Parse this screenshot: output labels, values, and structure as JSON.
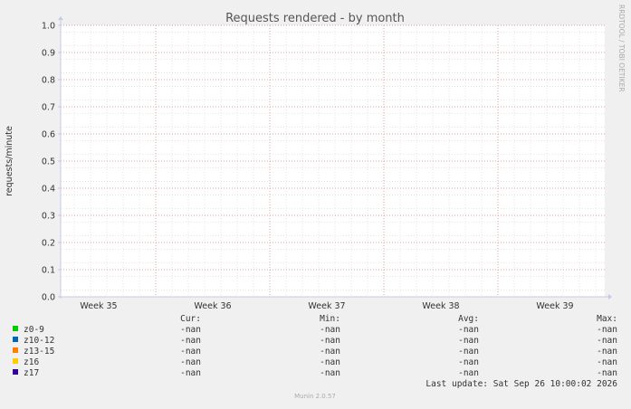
{
  "chart_data": {
    "type": "line",
    "title": "Requests rendered - by month",
    "ylabel": "requests/minute",
    "ylim": [
      0,
      1
    ],
    "y_ticks": [
      "0.0",
      "0.1",
      "0.2",
      "0.3",
      "0.4",
      "0.5",
      "0.6",
      "0.7",
      "0.8",
      "0.9",
      "1.0"
    ],
    "x_ticks": [
      "Week 35",
      "Week 36",
      "Week 37",
      "Week 38",
      "Week 39"
    ],
    "grid": true,
    "series": [
      {
        "name": "z0-9",
        "color": "#00cc00",
        "values": []
      },
      {
        "name": "z10-12",
        "color": "#0066b3",
        "values": []
      },
      {
        "name": "z13-15",
        "color": "#ff8000",
        "values": []
      },
      {
        "name": "z16",
        "color": "#ffcc00",
        "values": []
      },
      {
        "name": "z17",
        "color": "#330099",
        "values": []
      }
    ]
  },
  "legend": {
    "headers": [
      "Cur:",
      "Min:",
      "Avg:",
      "Max:"
    ],
    "rows": [
      {
        "name": "z0-9",
        "cur": "-nan",
        "min": "-nan",
        "avg": "-nan",
        "max": "-nan"
      },
      {
        "name": "z10-12",
        "cur": "-nan",
        "min": "-nan",
        "avg": "-nan",
        "max": "-nan"
      },
      {
        "name": "z13-15",
        "cur": "-nan",
        "min": "-nan",
        "avg": "-nan",
        "max": "-nan"
      },
      {
        "name": "z16",
        "cur": "-nan",
        "min": "-nan",
        "avg": "-nan",
        "max": "-nan"
      },
      {
        "name": "z17",
        "cur": "-nan",
        "min": "-nan",
        "avg": "-nan",
        "max": "-nan"
      }
    ]
  },
  "last_update": "Last update: Sat Sep 26 10:00:02 2026",
  "watermark": "RRDTOOL / TOBI OETIKER",
  "footer": "Munin 2.0.57"
}
